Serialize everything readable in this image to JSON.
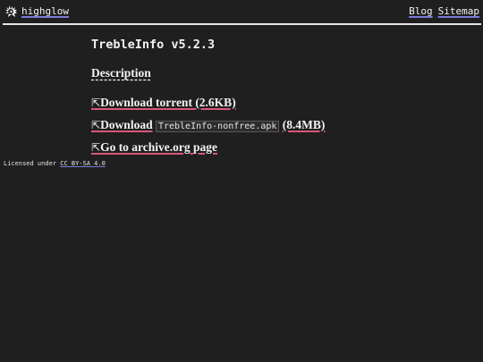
{
  "header": {
    "site_name": "highglow",
    "logo_icon": "spiky-creature-logo-icon",
    "nav": [
      {
        "label": "Blog"
      },
      {
        "label": "Sitemap"
      }
    ]
  },
  "main": {
    "title": "TrebleInfo v5.2.3",
    "description_label": "Description",
    "links": {
      "torrent": {
        "arrow": "⇱",
        "label": "Download torrent",
        "size": "(2.6KB)"
      },
      "apk": {
        "arrow": "⇱",
        "prefix": "Download",
        "filename": "TrebleInfo-nonfree.apk",
        "size": "(8.4MB)"
      },
      "archive": {
        "arrow": "⇱",
        "label": "Go to archive.org",
        "suffix": "page"
      }
    }
  },
  "footer": {
    "text": "Licensed under",
    "license_link": "CC BY-SA 4.0"
  },
  "colors": {
    "background": "#1f1f1f",
    "text": "#e6e6e6",
    "nav_underline": "#7a7ad9",
    "link_underline": "#d9577a"
  }
}
